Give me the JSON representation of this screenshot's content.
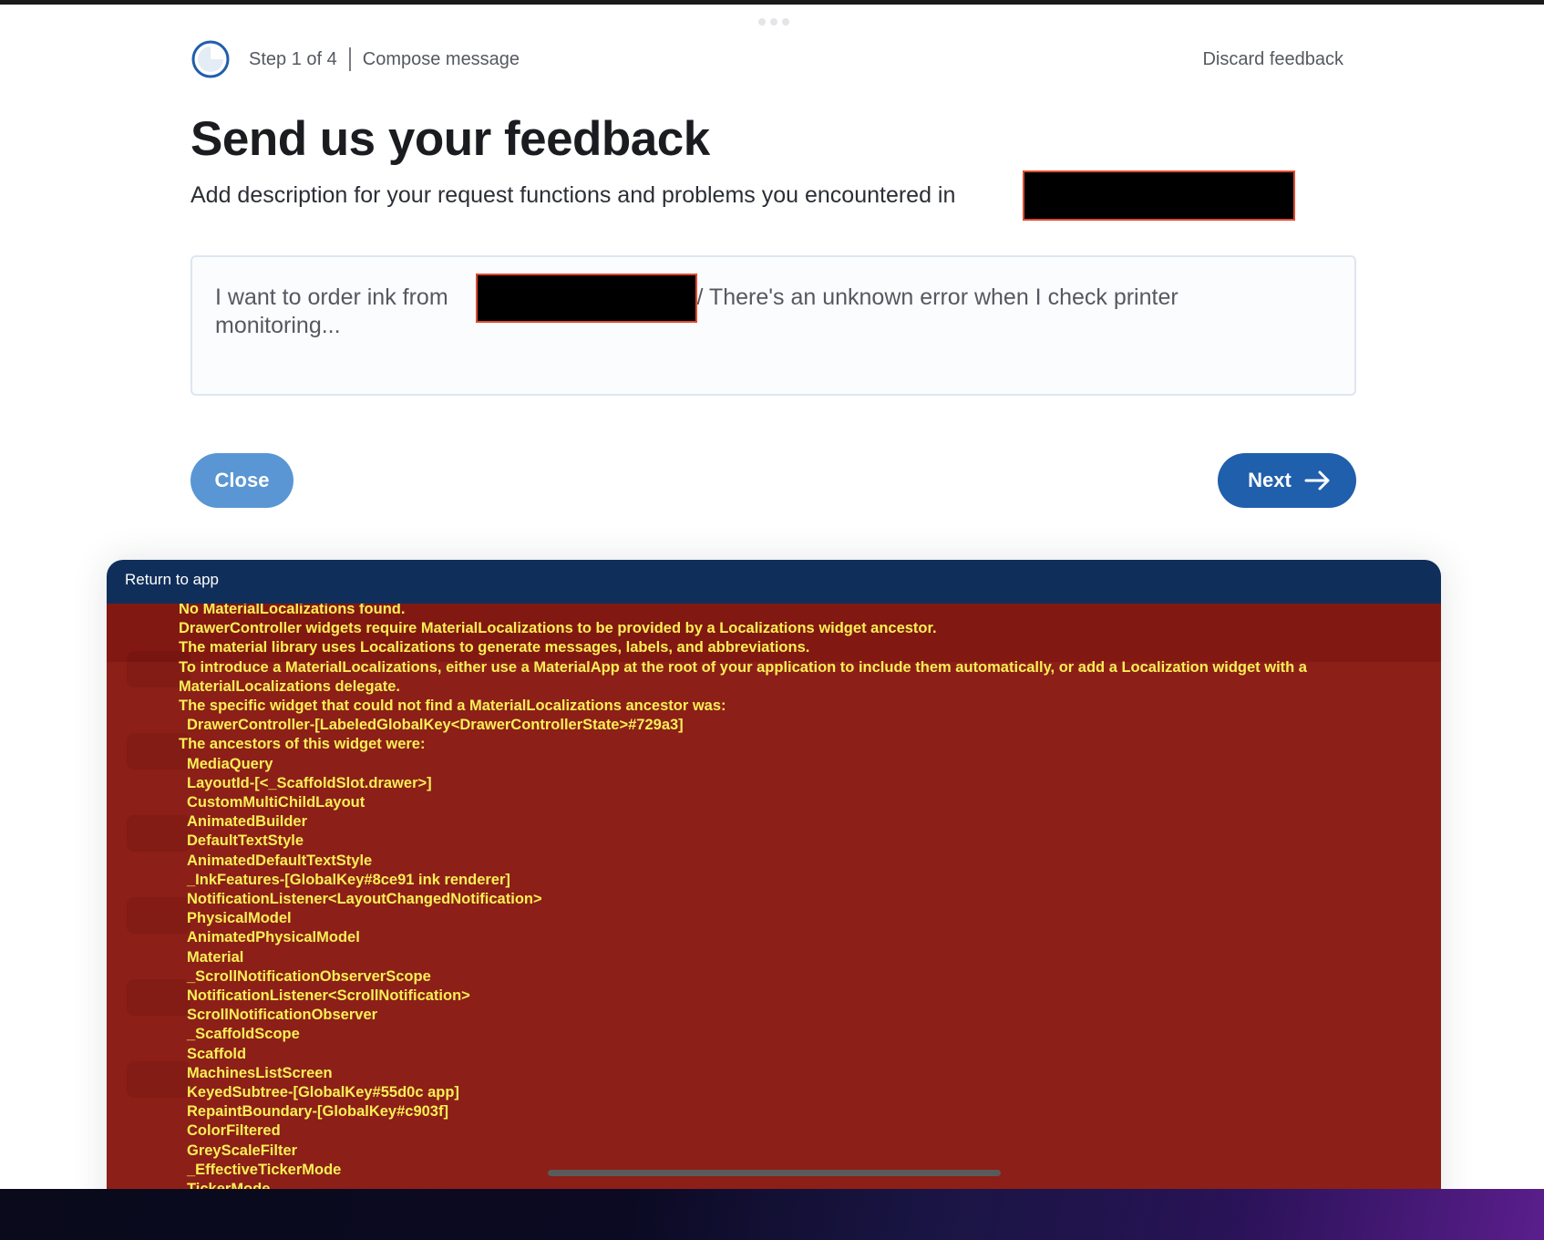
{
  "header": {
    "step_label": "Step 1 of 4",
    "step_title": "Compose message",
    "discard_label": "Discard feedback",
    "progress_fraction": 0.25
  },
  "main": {
    "title": "Send us your feedback",
    "subtitle": "Add description for your request functions and problems you encountered in",
    "placeholder_before": "I want to order ink from",
    "placeholder_after": ".. / There's an unknown error when I check printer monitoring..."
  },
  "buttons": {
    "close_label": "Close",
    "next_label": "Next"
  },
  "panel": {
    "return_label": "Return to app"
  },
  "error": {
    "lines": [
      "No MaterialLocalizations found.",
      "DrawerController widgets require MaterialLocalizations to be provided by a Localizations widget ancestor.",
      "The material library uses Localizations to generate messages, labels, and abbreviations.",
      "To introduce a MaterialLocalizations, either use a MaterialApp at the root of your application to include them automatically, or add a Localization widget with a MaterialLocalizations delegate.",
      "The specific widget that could not find a MaterialLocalizations ancestor was:",
      "DrawerController-[LabeledGlobalKey<DrawerControllerState>#729a3]",
      "The ancestors of this widget were:",
      "MediaQuery",
      "LayoutId-[<_ScaffoldSlot.drawer>]",
      "CustomMultiChildLayout",
      "AnimatedBuilder",
      "DefaultTextStyle",
      "AnimatedDefaultTextStyle",
      "_InkFeatures-[GlobalKey#8ce91 ink renderer]",
      "NotificationListener<LayoutChangedNotification>",
      "PhysicalModel",
      "AnimatedPhysicalModel",
      "Material",
      "_ScrollNotificationObserverScope",
      "NotificationListener<ScrollNotification>",
      "ScrollNotificationObserver",
      "_ScaffoldScope",
      "Scaffold",
      "MachinesListScreen",
      "KeyedSubtree-[GlobalKey#55d0c app]",
      "RepaintBoundary-[GlobalKey#c903f]",
      "ColorFiltered",
      "GreyScaleFilter",
      "_EffectiveTickerMode",
      "TickerMode"
    ]
  },
  "colors": {
    "primary": "#1f5fab",
    "close_button": "#5a96d4",
    "panel_header": "#0f2f5a",
    "error_background": "#8c1f18",
    "error_text": "#f9ef55",
    "redaction_border": "#e04a2f"
  },
  "icons": {
    "progress": "progress-ring-icon",
    "next": "arrow-right-icon"
  }
}
